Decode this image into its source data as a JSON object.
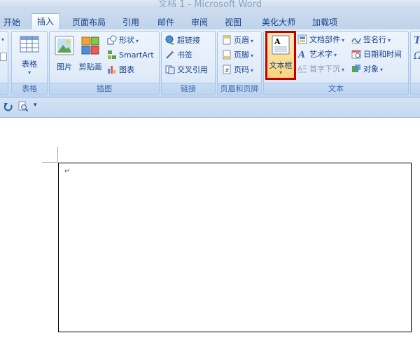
{
  "window": {
    "title": "文档 1 - Microsoft Word"
  },
  "tabs": [
    {
      "label": "开始"
    },
    {
      "label": "插入"
    },
    {
      "label": "页面布局"
    },
    {
      "label": "引用"
    },
    {
      "label": "邮件"
    },
    {
      "label": "审阅"
    },
    {
      "label": "视图"
    },
    {
      "label": "美化大师"
    },
    {
      "label": "加载项"
    }
  ],
  "ribbon": {
    "tables": {
      "label": "表格",
      "table_button": "表格"
    },
    "illustrations": {
      "label": "插图",
      "picture": "图片",
      "clipart": "剪贴画",
      "shapes": "形状",
      "smartart": "SmartArt",
      "chart": "图表"
    },
    "links": {
      "label": "链接",
      "hyperlink": "超链接",
      "bookmark": "书签",
      "crossref": "交叉引用"
    },
    "header_footer": {
      "label": "页眉和页脚",
      "header": "页眉",
      "footer": "页脚",
      "page_number": "页码"
    },
    "text": {
      "label": "文本",
      "textbox": "文本框",
      "quickparts": "文档部件",
      "wordart": "艺术字",
      "dropcap": "首字下沉",
      "signature": "签名行",
      "datetime": "日期和时间",
      "object": "对象"
    }
  },
  "colors": {
    "highlight": "#c00000"
  }
}
